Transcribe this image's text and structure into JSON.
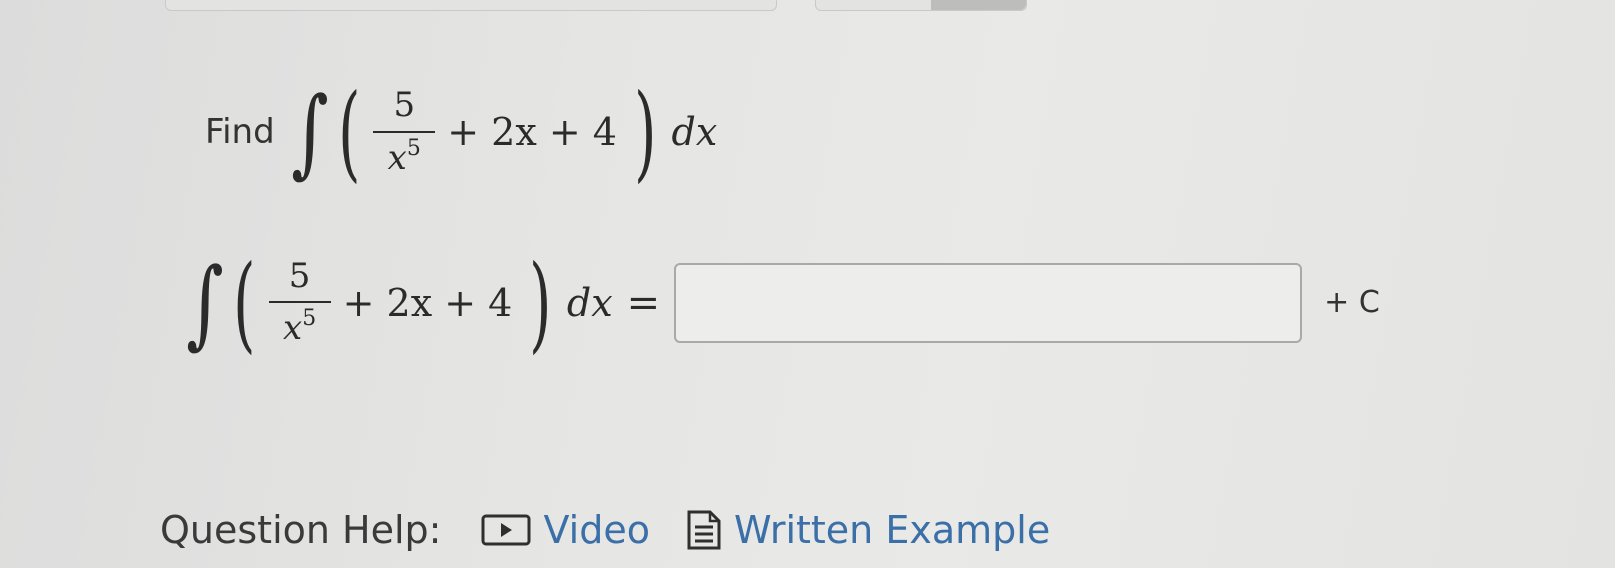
{
  "question": {
    "find_label": "Find",
    "integral_symbol": "∫",
    "open_paren": "(",
    "close_paren": ")",
    "fraction_numerator": "5",
    "fraction_denominator_var": "x",
    "fraction_denominator_exp": "5",
    "rest_terms": "+ 2x + 4",
    "differential": "dx"
  },
  "answer": {
    "equals": "=",
    "input_value": "",
    "constant_suffix": "+ C"
  },
  "help": {
    "label": "Question Help:",
    "video_label": "Video",
    "written_example_label": "Written Example",
    "video_icon": "video-play-icon",
    "written_example_icon": "document-icon"
  },
  "colors": {
    "link": "#3a6fa8",
    "text": "#2f2f2f"
  }
}
